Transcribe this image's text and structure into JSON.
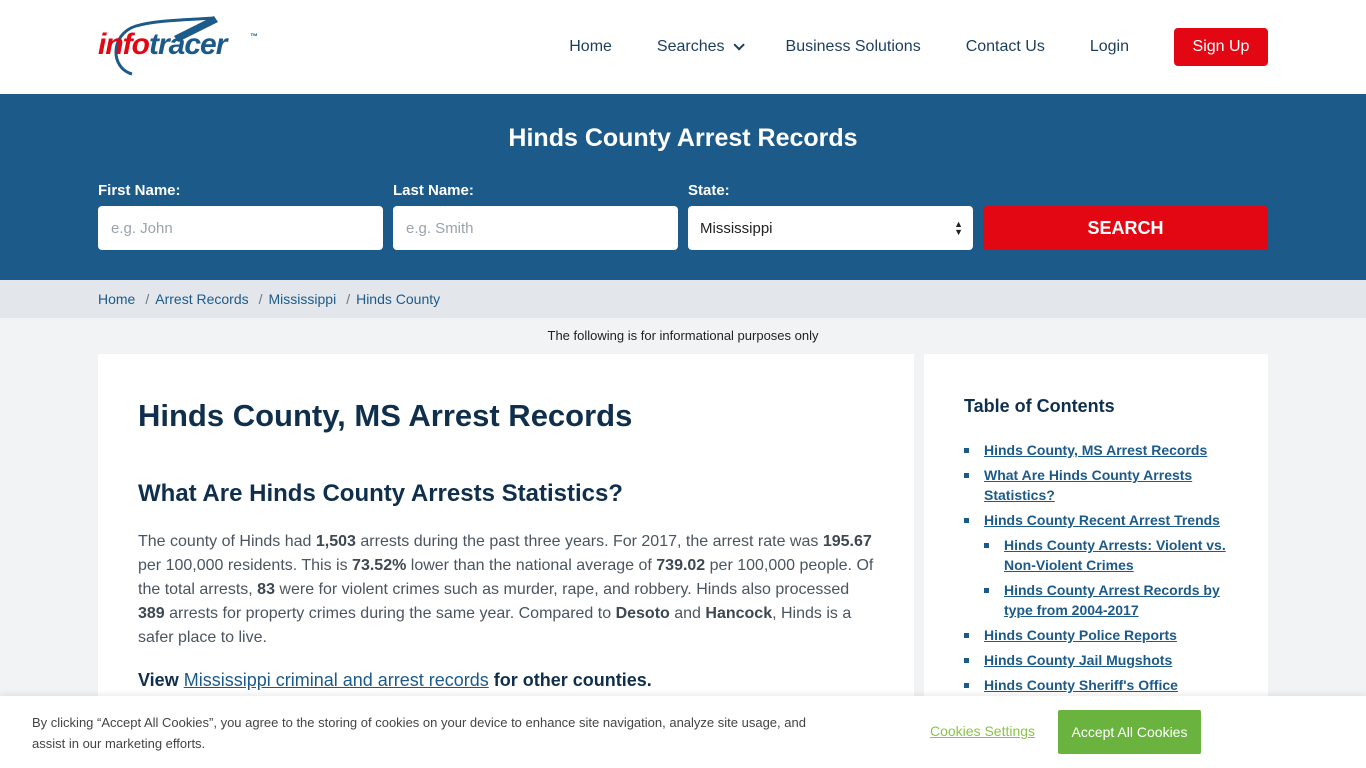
{
  "brand": {
    "part1": "info",
    "part2": "tracer",
    "tm": "™"
  },
  "nav": {
    "home": "Home",
    "searches": "Searches",
    "business": "Business Solutions",
    "contact": "Contact Us",
    "login": "Login",
    "signup": "Sign Up"
  },
  "search": {
    "title": "Hinds County Arrest Records",
    "first_label": "First Name:",
    "first_placeholder": "e.g. John",
    "last_label": "Last Name:",
    "last_placeholder": "e.g. Smith",
    "state_label": "State:",
    "state_value": "Mississippi",
    "button": "SEARCH"
  },
  "breadcrumb": [
    "Home",
    "Arrest Records",
    "Mississippi",
    "Hinds County"
  ],
  "disclaimer": "The following is for informational purposes only",
  "article": {
    "h1": "Hinds County, MS Arrest Records",
    "h2": "What Are Hinds County Arrests Statistics?",
    "p": [
      "The county of Hinds had ",
      "1,503",
      " arrests during the past three years. For 2017, the arrest rate was ",
      "195.67",
      " per 100,000 residents. This is ",
      "73.52%",
      " lower than the national average of ",
      "739.02",
      " per 100,000 people. Of the total arrests, ",
      "83",
      " were for violent crimes such as murder, rape, and robbery. Hinds also processed ",
      "389",
      " arrests for property crimes during the same year. Compared to ",
      "Desoto",
      " and ",
      "Hancock",
      ", Hinds is a safer place to live."
    ],
    "view_pre": "View ",
    "view_link": "Mississippi criminal and arrest records",
    "view_post": " for other counties."
  },
  "toc": {
    "title": "Table of Contents",
    "items": [
      "Hinds County, MS Arrest Records",
      "What Are Hinds County Arrests Statistics?",
      "Hinds County Recent Arrest Trends",
      "Hinds County Arrests: Violent vs. Non-Violent Crimes",
      "Hinds County Arrest Records by type from 2004-2017",
      "Hinds County Police Reports",
      "Hinds County Jail Mugshots",
      "Hinds County Sheriff's Office"
    ]
  },
  "cookie": {
    "text": "By clicking “Accept All Cookies”, you agree to the storing of cookies on your device to enhance site navigation, analyze site usage, and assist in our marketing efforts.",
    "settings": "Cookies Settings",
    "accept": "Accept All Cookies"
  },
  "colors": {
    "brand_blue": "#1c5a8a",
    "brand_red": "#e30613",
    "accept_green": "#6bb33f"
  }
}
